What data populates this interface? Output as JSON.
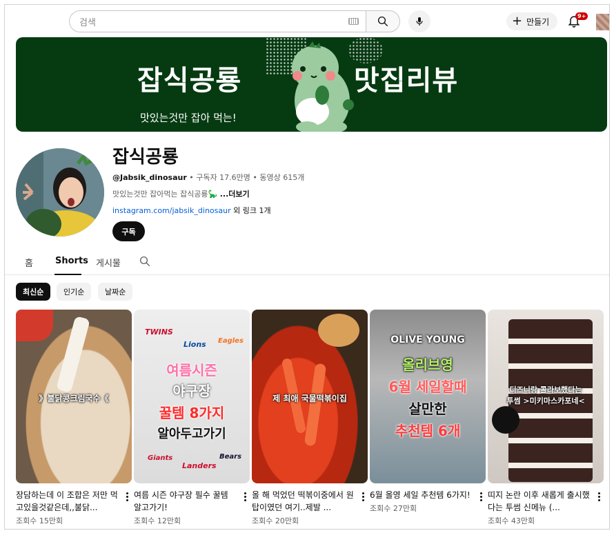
{
  "header": {
    "search_placeholder": "검색",
    "create_label": "만들기",
    "notification_badge": "9+"
  },
  "banner": {
    "left_title": "잡식공룡",
    "right_title": "맛집리뷰",
    "tagline": "맛있는것만 잡아 먹는!",
    "bg_color": "#063b12"
  },
  "channel": {
    "name": "잡식공룡",
    "handle": "@Jabsik_dinosaur",
    "subscribers": "• 구독자 17.6만명 • 동영상 615개",
    "description": "맛있는것만 잡아먹는 잡식공룡🦕 ",
    "more_label": "...더보기",
    "link_url": "instagram.com/jabsik_dinosaur",
    "link_extra": " 외 링크 1개",
    "subscribe_label": "구독"
  },
  "tabs": [
    {
      "label": "홈"
    },
    {
      "label": "Shorts"
    },
    {
      "label": "게시물"
    }
  ],
  "chips": [
    {
      "label": "최신순"
    },
    {
      "label": "인기순"
    },
    {
      "label": "날짜순"
    }
  ],
  "shorts": [
    {
      "caption": "》불닭콩크림국수《",
      "title": "장담하는데 이 조합은 저만 먹고있을것같은데,,불닭...",
      "views": "조회수 15만회"
    },
    {
      "caption_lines": [
        "여름시즌",
        "야구장",
        "꿀템 8가지",
        "알아두고가기"
      ],
      "title": "여름 시즌 야구장 필수 꿀템 알고가기!",
      "views": "조회수 12만회",
      "logos": [
        "TWINS",
        "Lions",
        "Eagles",
        "Giants",
        "Landers",
        "Bears"
      ]
    },
    {
      "caption": "제 최애 국물떡볶이집",
      "title": "올 해 먹었던 떡볶이중에서 원탑이였던 여기..제발 ...",
      "views": "조회수 20만회"
    },
    {
      "caption_lines": [
        "OLIVE YOUNG",
        "올리브영",
        "6월 세일할때",
        "살만한",
        "추천템 6개"
      ],
      "title": "6월 올영 세일 추천템 6가지!",
      "views": "조회수 27만회"
    },
    {
      "caption_lines": [
        "디즈니랑 콜라보했다는",
        "투썸 >미키마스카포네<"
      ],
      "title": "띠지 논란 이후 새롭게 출시했다는 투썸 신메뉴 (...",
      "views": "조회수 43만회"
    }
  ]
}
